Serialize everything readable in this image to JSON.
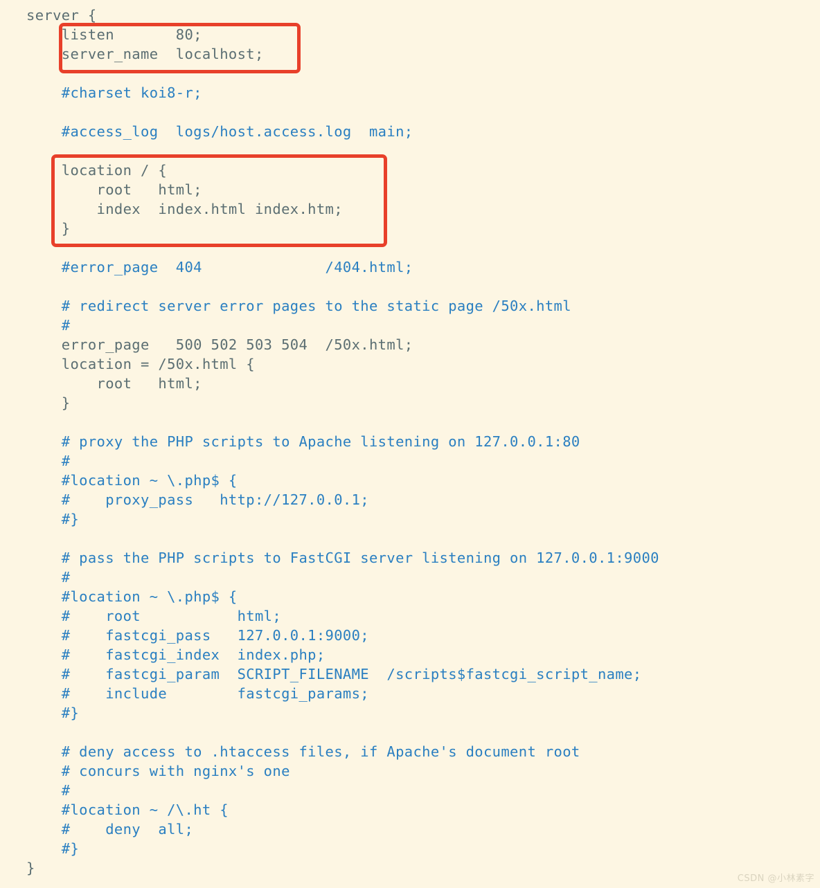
{
  "document": {
    "kind": "nginx-configuration-file",
    "background_color": "#fdf6e3",
    "code_color": "#5b6e72",
    "comment_color": "#2a7fc1",
    "annotation_color": "#e8402a"
  },
  "code": {
    "lines": [
      {
        "text": "server {",
        "type": "code"
      },
      {
        "text": "    listen       80;",
        "type": "code"
      },
      {
        "text": "    server_name  localhost;",
        "type": "code"
      },
      {
        "text": "",
        "type": "blank"
      },
      {
        "text": "    #charset koi8-r;",
        "type": "comment"
      },
      {
        "text": "",
        "type": "blank"
      },
      {
        "text": "    #access_log  logs/host.access.log  main;",
        "type": "comment"
      },
      {
        "text": "",
        "type": "blank"
      },
      {
        "text": "    location / {",
        "type": "code"
      },
      {
        "text": "        root   html;",
        "type": "code"
      },
      {
        "text": "        index  index.html index.htm;",
        "type": "code"
      },
      {
        "text": "    }",
        "type": "code"
      },
      {
        "text": "",
        "type": "blank"
      },
      {
        "text": "    #error_page  404              /404.html;",
        "type": "comment"
      },
      {
        "text": "",
        "type": "blank"
      },
      {
        "text": "    # redirect server error pages to the static page /50x.html",
        "type": "comment"
      },
      {
        "text": "    #",
        "type": "comment"
      },
      {
        "text": "    error_page   500 502 503 504  /50x.html;",
        "type": "code"
      },
      {
        "text": "    location = /50x.html {",
        "type": "code"
      },
      {
        "text": "        root   html;",
        "type": "code"
      },
      {
        "text": "    }",
        "type": "code"
      },
      {
        "text": "",
        "type": "blank"
      },
      {
        "text": "    # proxy the PHP scripts to Apache listening on 127.0.0.1:80",
        "type": "comment"
      },
      {
        "text": "    #",
        "type": "comment"
      },
      {
        "text": "    #location ~ \\.php$ {",
        "type": "comment"
      },
      {
        "text": "    #    proxy_pass   http://127.0.0.1;",
        "type": "comment"
      },
      {
        "text": "    #}",
        "type": "comment"
      },
      {
        "text": "",
        "type": "blank"
      },
      {
        "text": "    # pass the PHP scripts to FastCGI server listening on 127.0.0.1:9000",
        "type": "comment"
      },
      {
        "text": "    #",
        "type": "comment"
      },
      {
        "text": "    #location ~ \\.php$ {",
        "type": "comment"
      },
      {
        "text": "    #    root           html;",
        "type": "comment"
      },
      {
        "text": "    #    fastcgi_pass   127.0.0.1:9000;",
        "type": "comment"
      },
      {
        "text": "    #    fastcgi_index  index.php;",
        "type": "comment"
      },
      {
        "text": "    #    fastcgi_param  SCRIPT_FILENAME  /scripts$fastcgi_script_name;",
        "type": "comment"
      },
      {
        "text": "    #    include        fastcgi_params;",
        "type": "comment"
      },
      {
        "text": "    #}",
        "type": "comment"
      },
      {
        "text": "",
        "type": "blank"
      },
      {
        "text": "    # deny access to .htaccess files, if Apache's document root",
        "type": "comment"
      },
      {
        "text": "    # concurs with nginx's one",
        "type": "comment"
      },
      {
        "text": "    #",
        "type": "comment"
      },
      {
        "text": "    #location ~ /\\.ht {",
        "type": "comment"
      },
      {
        "text": "    #    deny  all;",
        "type": "comment"
      },
      {
        "text": "    #}",
        "type": "comment"
      },
      {
        "text": "}",
        "type": "code"
      }
    ]
  },
  "annotations": [
    {
      "id": "hl-server-listen",
      "label": "listen-and-server-name-highlight",
      "covers": [
        "listen       80;",
        "server_name  localhost;"
      ]
    },
    {
      "id": "hl-location-root",
      "label": "location-root-index-highlight",
      "covers": [
        "location / {",
        "root   html;",
        "index  index.html index.htm;",
        "}"
      ]
    }
  ],
  "watermark": {
    "text": "CSDN @小林素字"
  }
}
